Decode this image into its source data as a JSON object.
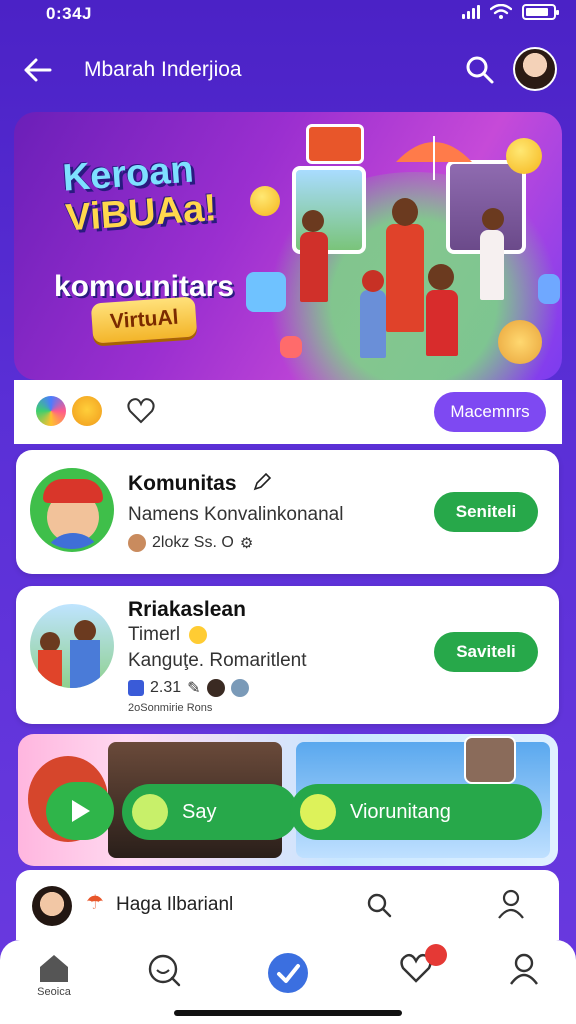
{
  "status_bar": {
    "time": "0:34J"
  },
  "header": {
    "title": "Mbarah Inderjioa"
  },
  "hero": {
    "title_line1": "Keroan",
    "title_line2": "ViBUAa!",
    "subtitle": "komounitars",
    "badge": "VirtuAl"
  },
  "actions": {
    "members_label": "Macemnrs"
  },
  "cards": [
    {
      "title": "Komunitas",
      "subtitle": "Namens Konvalinkonanal",
      "meta": "2lokz Ss. O",
      "button": "Seniteli"
    },
    {
      "title": "Rriakaslean",
      "line1": "Timerl",
      "line2": "Kanguţe. Romaritlent",
      "meta": "2.31",
      "footnote": "2oSonmirie Rons",
      "button": "Saviteli"
    }
  ],
  "media": {
    "pill1": "Say",
    "pill2": "Viorunitang"
  },
  "compose": {
    "text": "Haga Ilbarianl"
  },
  "tabs": [
    {
      "label": "Seoica",
      "icon": "home-icon"
    },
    {
      "label": "",
      "icon": "chat-search-icon"
    },
    {
      "label": "",
      "icon": "check-icon"
    },
    {
      "label": "",
      "icon": "heart-icon",
      "badge": ""
    },
    {
      "label": "",
      "icon": "profile-icon"
    }
  ],
  "colors": {
    "primary": "#5a2fd6",
    "accent_green": "#27a84a",
    "accent_purple": "#7e49f2"
  }
}
